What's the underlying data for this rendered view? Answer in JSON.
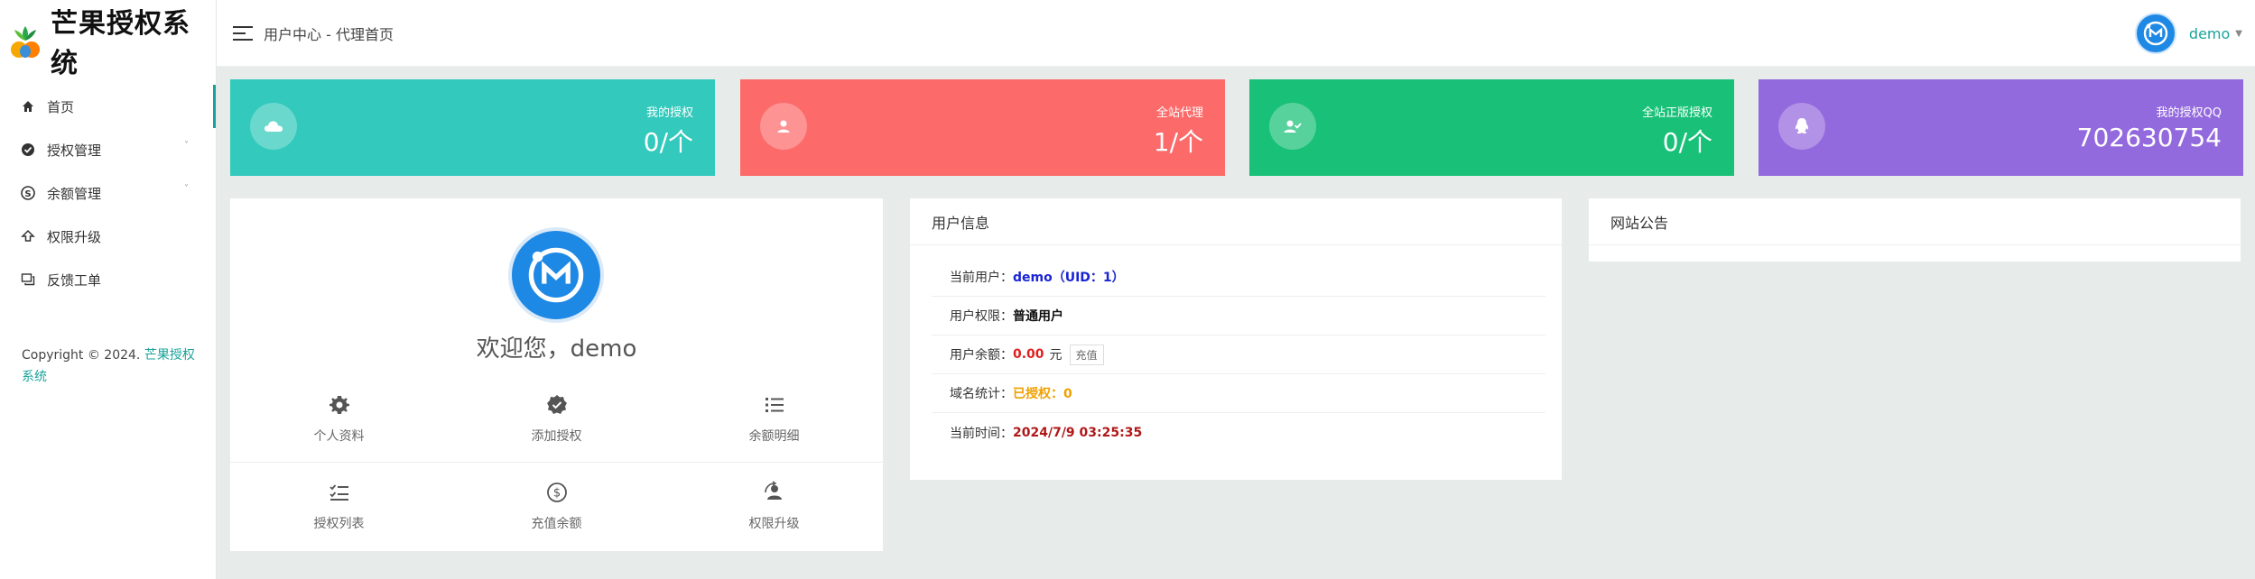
{
  "brand": {
    "name": "芒果授权系统"
  },
  "topbar": {
    "breadcrumb": "用户中心 - 代理首页",
    "username": "demo"
  },
  "sidebar": {
    "items": [
      {
        "label": "首页",
        "icon": "home-icon",
        "active": true,
        "has_sub": false
      },
      {
        "label": "授权管理",
        "icon": "check-circle-icon",
        "active": false,
        "has_sub": true
      },
      {
        "label": "余额管理",
        "icon": "skype-icon",
        "active": false,
        "has_sub": true
      },
      {
        "label": "权限升级",
        "icon": "upgrade-icon",
        "active": false,
        "has_sub": false
      },
      {
        "label": "反馈工单",
        "icon": "chat-icon",
        "active": false,
        "has_sub": false
      }
    ],
    "copyright_prefix": "Copyright © 2024.",
    "copyright_link": "芒果授权系统"
  },
  "stats": [
    {
      "label": "我的授权",
      "value": "0/个",
      "color": "#33c9bc",
      "icon": "cloud-icon"
    },
    {
      "label": "全站代理",
      "value": "1/个",
      "color": "#fc6a6a",
      "icon": "user-icon"
    },
    {
      "label": "全站正版授权",
      "value": "0/个",
      "color": "#18c177",
      "icon": "user-check-icon"
    },
    {
      "label": "我的授权QQ",
      "value": "702630754",
      "color": "#9369de",
      "icon": "qq-icon"
    }
  ],
  "profile": {
    "welcome": "欢迎您，demo",
    "quick": [
      {
        "label": "个人资料",
        "icon": "gear-icon"
      },
      {
        "label": "添加授权",
        "icon": "verified-badge-icon"
      },
      {
        "label": "余额明细",
        "icon": "list-icon"
      },
      {
        "label": "授权列表",
        "icon": "checklist-icon"
      },
      {
        "label": "充值余额",
        "icon": "dollar-icon"
      },
      {
        "label": "权限升级",
        "icon": "user-upgrade-icon"
      }
    ]
  },
  "userinfo": {
    "title": "用户信息",
    "current_user_label": "当前用户：",
    "current_user_value": "demo（UID：1）",
    "permission_label": "用户权限：",
    "permission_value": "普通用户",
    "balance_label": "用户余额：",
    "balance_value": "0.00",
    "balance_unit": "元",
    "recharge_button": "充值",
    "domain_label": "域名统计：",
    "domain_value": "已授权：0",
    "time_label": "当前时间：",
    "time_value": "2024/7/9 03:25:35"
  },
  "notice": {
    "title": "网站公告"
  },
  "colors": {
    "accent": "#1aa39a",
    "avatar_blue": "#1e88e5"
  }
}
